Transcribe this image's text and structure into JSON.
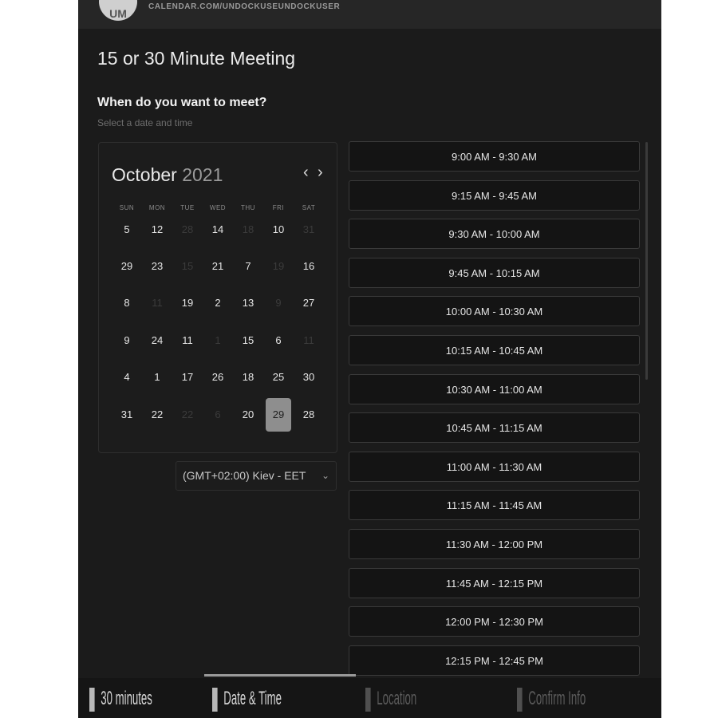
{
  "header": {
    "avatar_initials": "UM",
    "profile_url": "CALENDAR.COM/UNDOCKUSEUNDOCKUSER"
  },
  "meeting": {
    "title": "15 or 30 Minute Meeting",
    "prompt_heading": "When do you want to meet?",
    "prompt_sub": "Select a date and time"
  },
  "calendar": {
    "month": "October",
    "year": "2021",
    "nav_prev": "‹",
    "nav_next": "›",
    "weekdays": [
      "SUN",
      "MON",
      "TUE",
      "WED",
      "THU",
      "FRI",
      "SAT"
    ],
    "weeks": [
      [
        {
          "d": "5"
        },
        {
          "d": "12"
        },
        {
          "d": "28",
          "muted": true
        },
        {
          "d": "14"
        },
        {
          "d": "18",
          "muted": true
        },
        {
          "d": "10"
        },
        {
          "d": "31",
          "muted": true
        }
      ],
      [
        {
          "d": "29"
        },
        {
          "d": "23"
        },
        {
          "d": "15",
          "muted": true
        },
        {
          "d": "21"
        },
        {
          "d": "7"
        },
        {
          "d": "19",
          "muted": true
        },
        {
          "d": "16"
        }
      ],
      [
        {
          "d": "8"
        },
        {
          "d": "11",
          "muted": true
        },
        {
          "d": "19"
        },
        {
          "d": "2"
        },
        {
          "d": "13"
        },
        {
          "d": "9",
          "muted": true
        },
        {
          "d": "27"
        }
      ],
      [
        {
          "d": "9"
        },
        {
          "d": "24"
        },
        {
          "d": "11"
        },
        {
          "d": "1",
          "muted": true
        },
        {
          "d": "15"
        },
        {
          "d": "6"
        },
        {
          "d": "11",
          "muted": true
        }
      ],
      [
        {
          "d": "4"
        },
        {
          "d": "1"
        },
        {
          "d": "17"
        },
        {
          "d": "26"
        },
        {
          "d": "18"
        },
        {
          "d": "25"
        },
        {
          "d": "30"
        }
      ],
      [
        {
          "d": "31"
        },
        {
          "d": "22"
        },
        {
          "d": "22",
          "muted": true
        },
        {
          "d": "6",
          "muted": true
        },
        {
          "d": "20"
        },
        {
          "d": "29",
          "selected": true
        },
        {
          "d": "28"
        }
      ]
    ]
  },
  "timezone": {
    "selected": "(GMT+02:00) Kiev - EET",
    "chevron": "⌄"
  },
  "time_slots": [
    "9:00 AM - 9:30 AM",
    "9:15 AM - 9:45 AM",
    "9:30 AM - 10:00 AM",
    "9:45 AM - 10:15 AM",
    "10:00 AM - 10:30 AM",
    "10:15 AM - 10:45 AM",
    "10:30 AM - 11:00 AM",
    "10:45 AM - 11:15 AM",
    "11:00 AM - 11:30 AM",
    "11:15 AM - 11:45 AM",
    "11:30 AM - 12:00 PM",
    "11:45 AM - 12:15 PM",
    "12:00 PM - 12:30 PM",
    "12:15 PM - 12:45 PM"
  ],
  "steps": [
    {
      "label": "30 minutes",
      "active": false
    },
    {
      "label": "Date & Time",
      "active": true
    },
    {
      "label": "Location",
      "active": false
    },
    {
      "label": "Confirm Info",
      "active": false
    }
  ],
  "colors": {
    "background": "#1b1b1b",
    "selected_day": "#8e8e8e",
    "slot_border": "#3a3a3a"
  }
}
